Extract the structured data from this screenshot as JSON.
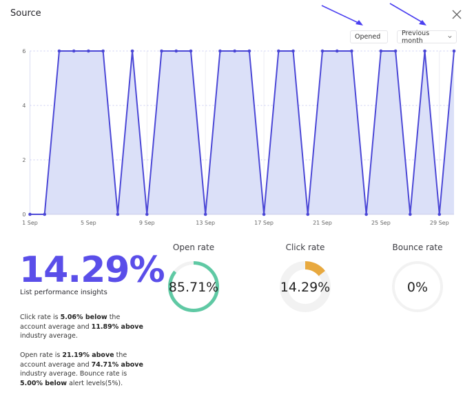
{
  "header": {
    "title": "Source",
    "close_icon": "close-icon",
    "metric_dropdown": {
      "selected": "Opened"
    },
    "period_dropdown": {
      "selected": "Previous month"
    }
  },
  "annotations": {
    "arrow_color": "#4a3ff0"
  },
  "colors": {
    "accent": "#5a4ee9",
    "line": "#4b47d6",
    "fill": "#dbe0f8",
    "open_ring": "#5fc9a4",
    "click_ring": "#e8a93f",
    "track": "#f2f2f2"
  },
  "chart_data": {
    "type": "area",
    "title": "",
    "xlabel": "",
    "ylabel": "",
    "x": [
      "1 Sep",
      "2 Sep",
      "3 Sep",
      "4 Sep",
      "5 Sep",
      "6 Sep",
      "7 Sep",
      "8 Sep",
      "9 Sep",
      "10 Sep",
      "11 Sep",
      "12 Sep",
      "13 Sep",
      "14 Sep",
      "15 Sep",
      "16 Sep",
      "17 Sep",
      "18 Sep",
      "19 Sep",
      "20 Sep",
      "21 Sep",
      "22 Sep",
      "23 Sep",
      "24 Sep",
      "25 Sep",
      "26 Sep",
      "27 Sep",
      "28 Sep",
      "29 Sep",
      "30 Sep"
    ],
    "values": [
      0,
      0,
      6,
      6,
      6,
      6,
      0,
      6,
      0,
      6,
      6,
      6,
      0,
      6,
      6,
      6,
      0,
      6,
      6,
      0,
      6,
      6,
      6,
      0,
      6,
      6,
      0,
      6,
      0,
      6
    ],
    "x_tick_labels": [
      "1 Sep",
      "5 Sep",
      "9 Sep",
      "13 Sep",
      "17 Sep",
      "21 Sep",
      "25 Sep",
      "29 Sep"
    ],
    "y_ticks": [
      0,
      2,
      4,
      6
    ],
    "ylim": [
      0,
      6
    ],
    "grid": true,
    "legend": "none"
  },
  "summary": {
    "headline": "14.29%",
    "subtitle": "List performance insights",
    "para1": [
      {
        "t": "Click rate is ",
        "b": false
      },
      {
        "t": "5.06% below",
        "b": true
      },
      {
        "t": " the account average and ",
        "b": false
      },
      {
        "t": "11.89% above",
        "b": true
      },
      {
        "t": " industry average.",
        "b": false
      }
    ],
    "para2": [
      {
        "t": "Open rate is ",
        "b": false
      },
      {
        "t": "21.19% above",
        "b": true
      },
      {
        "t": " the account average and ",
        "b": false
      },
      {
        "t": "74.71% above",
        "b": true
      },
      {
        "t": " industry average. Bounce rate is ",
        "b": false
      },
      {
        "t": "5.00% below",
        "b": true
      },
      {
        "t": " alert levels(5%).",
        "b": false
      }
    ]
  },
  "gauges": [
    {
      "label": "Open rate",
      "value_text": "85.71%",
      "fraction": 0.8571
    },
    {
      "label": "Click rate",
      "value_text": "14.29%",
      "fraction": 0.1429
    },
    {
      "label": "Bounce rate",
      "value_text": "0%",
      "fraction": 0
    }
  ]
}
